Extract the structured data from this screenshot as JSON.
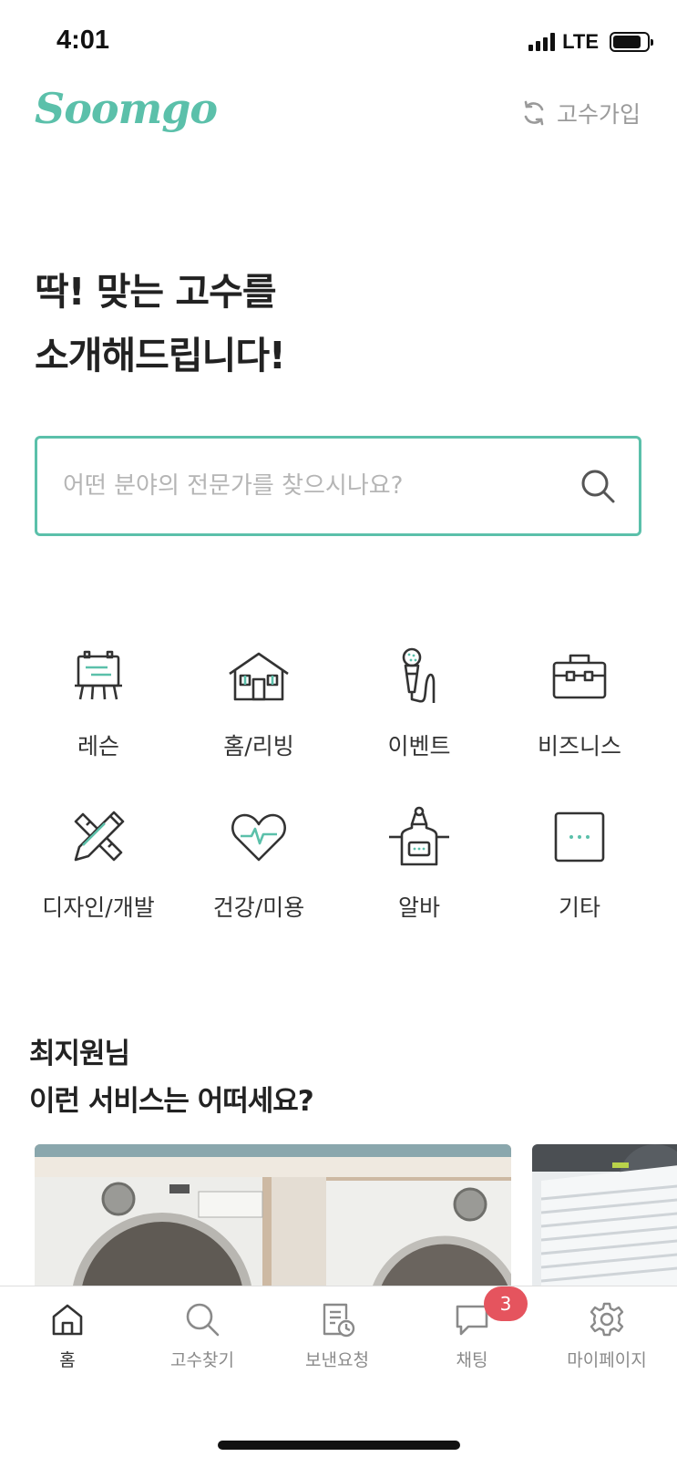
{
  "status_bar": {
    "time": "4:01",
    "network": "LTE"
  },
  "header": {
    "logo": "Soomgo",
    "pro_join_label": "고수가입"
  },
  "hero": {
    "line1": "딱! 맞는 고수를",
    "line2": "소개해드립니다!"
  },
  "search": {
    "placeholder": "어떤 분야의 전문가를 찾으시나요?",
    "value": ""
  },
  "categories": [
    {
      "label": "레슨",
      "icon": "easel-icon"
    },
    {
      "label": "홈/리빙",
      "icon": "house-icon"
    },
    {
      "label": "이벤트",
      "icon": "microphone-icon"
    },
    {
      "label": "비즈니스",
      "icon": "briefcase-icon"
    },
    {
      "label": "디자인/개발",
      "icon": "pencil-ruler-icon"
    },
    {
      "label": "건강/미용",
      "icon": "heart-pulse-icon"
    },
    {
      "label": "알바",
      "icon": "apron-icon"
    },
    {
      "label": "기타",
      "icon": "more-icon"
    }
  ],
  "recommendation": {
    "line1": "최지원님",
    "line2": "이런 서비스는 어떠세요?"
  },
  "tab_bar": {
    "tabs": [
      {
        "label": "홈",
        "icon": "home-icon",
        "active": true
      },
      {
        "label": "고수찾기",
        "icon": "search-icon",
        "active": false
      },
      {
        "label": "보낸요청",
        "icon": "request-icon",
        "active": false
      },
      {
        "label": "채팅",
        "icon": "chat-icon",
        "active": false,
        "badge": "3"
      },
      {
        "label": "마이페이지",
        "icon": "settings-icon",
        "active": false
      }
    ]
  },
  "colors": {
    "brand": "#5bc0aa",
    "badge": "#e5545e",
    "text": "#333333",
    "muted": "#8a8a8a"
  }
}
